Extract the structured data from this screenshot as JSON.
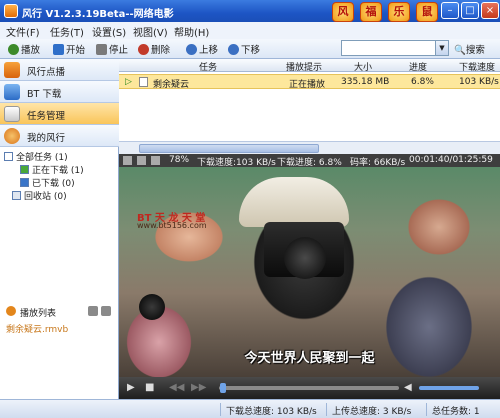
{
  "window": {
    "title": "风行 V1.2.3.19Beta--网络电影",
    "deco": [
      "风",
      "福",
      "乐",
      "鼠"
    ],
    "minimize": "–",
    "maximize": "□",
    "close": "×"
  },
  "menu": [
    "文件(F)",
    "任务(T)",
    "设置(S)",
    "视图(V)",
    "帮助(H)"
  ],
  "toolbar": {
    "play": "播放",
    "start": "开始",
    "stop": "停止",
    "delete": "删除",
    "up": "上移",
    "down": "下移",
    "search_button": "搜索",
    "search_value": ""
  },
  "sidebar": {
    "nav": [
      "风行点播",
      "BT 下载",
      "任务管理",
      "我的风行"
    ],
    "tree": {
      "all": "全部任务 (1)",
      "downloading": "正在下载 (1)",
      "downloaded": "已下载 (0)",
      "recycle": "回收站 (0)"
    },
    "playlist_title": "播放列表",
    "playlist_items": [
      "剩余疑云.rmvb"
    ]
  },
  "task_list": {
    "columns": [
      "任务",
      "播放提示",
      "大小",
      "进度",
      "下载速度"
    ],
    "rows": [
      {
        "name": "剩余疑云",
        "hint": "正在播放",
        "size": "335.18 MB",
        "progress": "6.8%",
        "speed": "103 KB/s"
      }
    ]
  },
  "player": {
    "zoom": "78%",
    "speed": "下载速度:103 KB/s",
    "progress": "下载进度: 6.8%",
    "bitrate": "码率: 66KB/s",
    "time": "00:01:40/01:25:59",
    "logo": "BT 天 龙 天 堂",
    "logo_url": "www.bt5156.com",
    "subtitle": "今天世界人民聚到一起",
    "seek_fraction": 0.02
  },
  "status": {
    "down_total": "下载总速度: 103 KB/s",
    "up_total": "上传总速度: 3 KB/s",
    "task_count": "总任务数: 1"
  }
}
